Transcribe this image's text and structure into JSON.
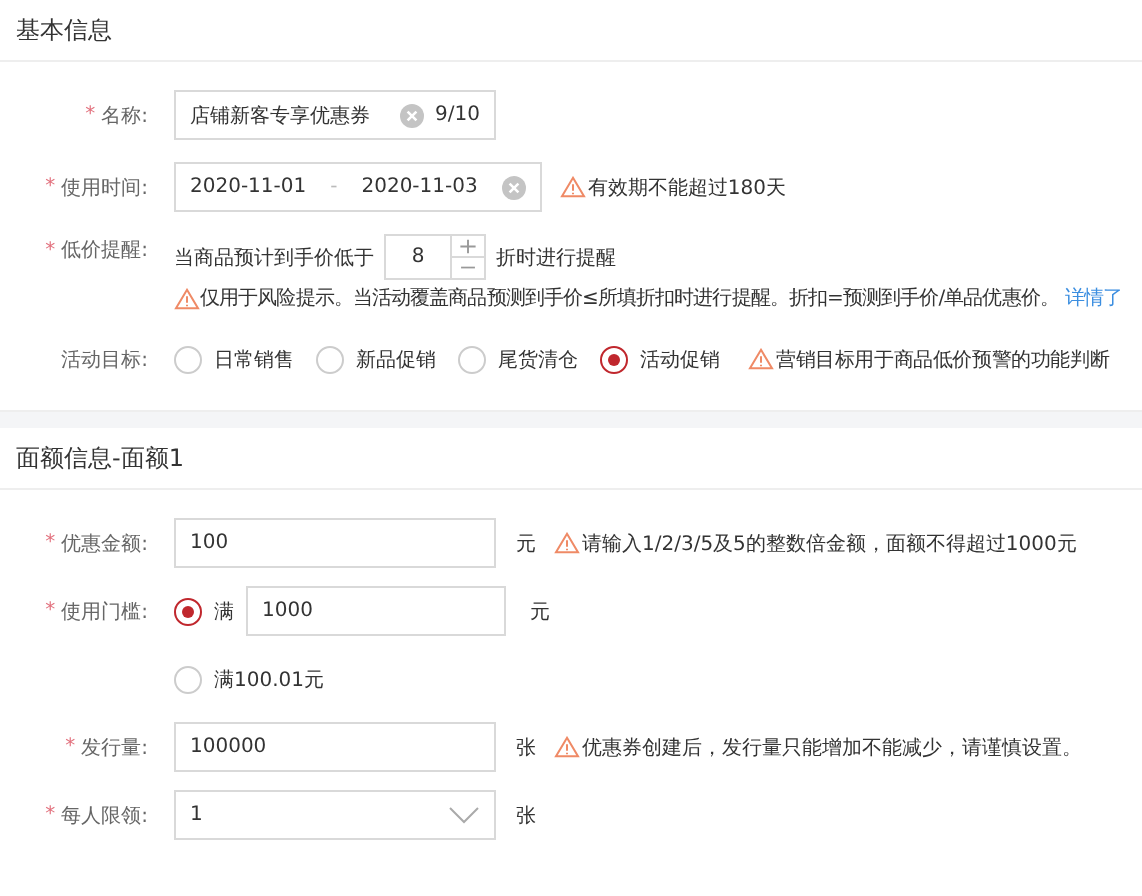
{
  "required_mark": "*",
  "basic": {
    "title": "基本信息",
    "name": {
      "label": "名称:",
      "required": true,
      "value": "店铺新客专享优惠券",
      "counter": "9/10"
    },
    "time": {
      "label": "使用时间:",
      "required": true,
      "start": "2020-11-01",
      "separator": "-",
      "end": "2020-11-03",
      "warning": "有效期不能超过180天"
    },
    "low_price": {
      "label": "低价提醒:",
      "required": true,
      "prefix": "当商品预计到手价低于",
      "value": "8",
      "suffix": "折时进行提醒",
      "note": "仅用于风险提示。当活动覆盖商品预测到手价≤所填折扣时进行提醒。折扣=预测到手价/单品优惠价。",
      "link": "详情了"
    },
    "goal": {
      "label": "活动目标:",
      "required": false,
      "options": [
        {
          "label": "日常销售",
          "selected": false
        },
        {
          "label": "新品促销",
          "selected": false
        },
        {
          "label": "尾货清仓",
          "selected": false
        },
        {
          "label": "活动促销",
          "selected": true
        }
      ],
      "warning": "营销目标用于商品低价预警的功能判断"
    }
  },
  "face": {
    "title": "面额信息-面额1",
    "amount": {
      "label": "优惠金额:",
      "required": true,
      "value": "100",
      "unit": "元",
      "warning": "请输入1/2/3/5及5的整数倍金额，面额不得超过1000元"
    },
    "threshold": {
      "label": "使用门槛:",
      "required": true,
      "options": [
        {
          "label": "满",
          "selected": true,
          "value": "1000",
          "unit": "元"
        },
        {
          "label": "满100.01元",
          "selected": false
        }
      ]
    },
    "quantity": {
      "label": "发行量:",
      "required": true,
      "value": "100000",
      "unit": "张",
      "warning": "优惠券创建后，发行量只能增加不能减少，请谨慎设置。"
    },
    "limit": {
      "label": "每人限领:",
      "required": true,
      "value": "1",
      "unit": "张"
    }
  }
}
